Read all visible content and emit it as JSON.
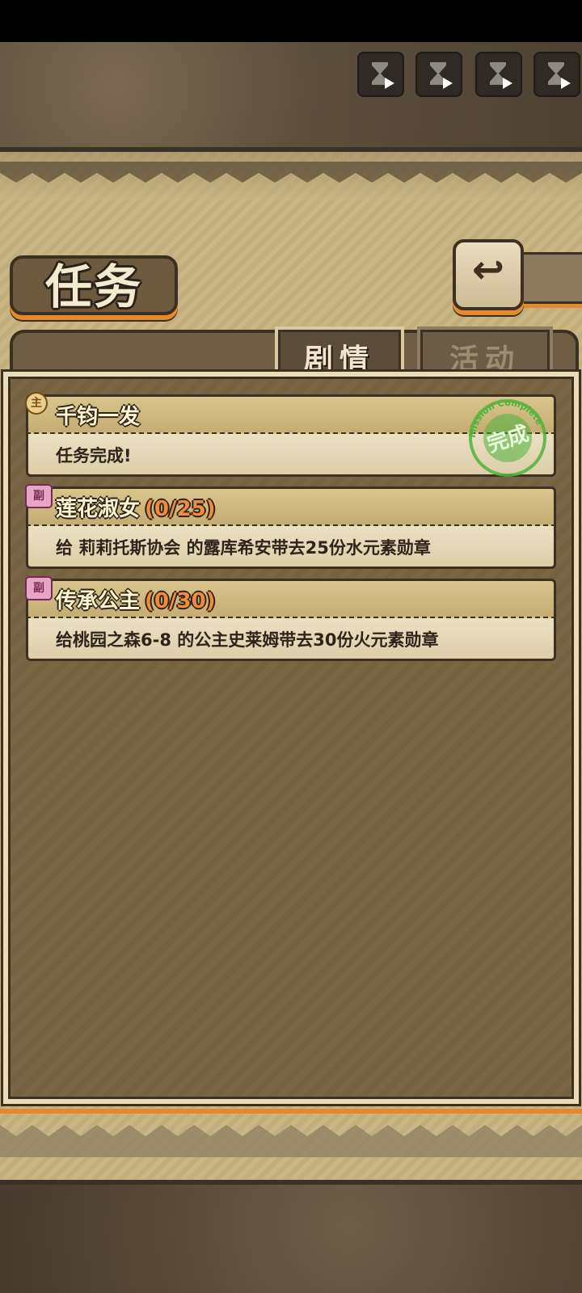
{
  "page": {
    "title": "任务",
    "back_icon": "↩"
  },
  "tabs": [
    {
      "label": "剧情",
      "active": true
    },
    {
      "label": "活动",
      "active": false
    }
  ],
  "quests": [
    {
      "type_badge": "主",
      "name": "千钧一发",
      "progress": "",
      "description": "任务完成!",
      "completed": true,
      "stamp_text": "完成",
      "stamp_ring_text": "Mission Complete"
    },
    {
      "type_badge": "副",
      "name": "莲花淑女",
      "progress": "(0/25)",
      "description": "给 莉莉托斯协会 的露库希安带去25份水元素勋章",
      "completed": false
    },
    {
      "type_badge": "副",
      "name": "传承公主",
      "progress": "(0/30)",
      "description": "给桃园之森6-8 的公主史莱姆带去30份火元素勋章",
      "completed": false
    }
  ],
  "colors": {
    "accent_orange": "#e48a2a",
    "progress": "#f08b3f",
    "stamp_green": "#4fb33c"
  }
}
